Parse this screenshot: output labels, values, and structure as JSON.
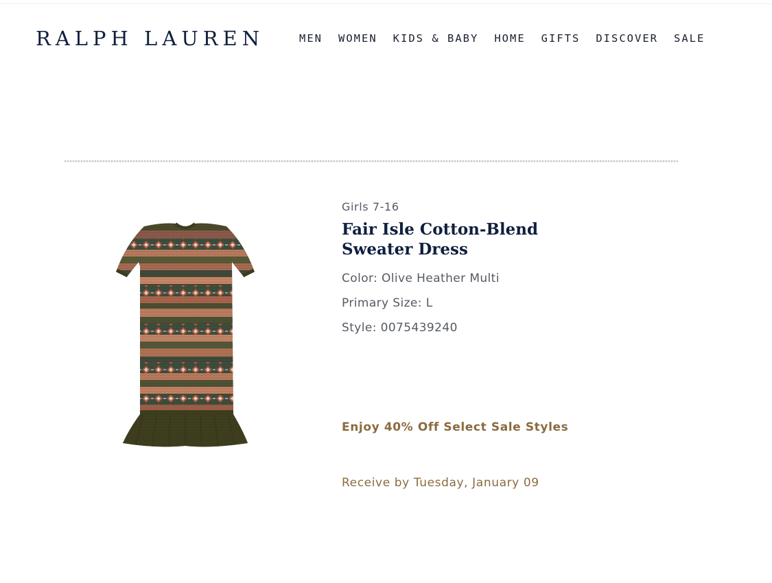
{
  "header": {
    "logo": "RALPH LAUREN",
    "nav": [
      "MEN",
      "WOMEN",
      "KIDS & BABY",
      "HOME",
      "GIFTS",
      "DISCOVER",
      "SALE"
    ]
  },
  "product": {
    "category": "Girls 7-16",
    "title": "Fair Isle Cotton-Blend Sweater Dress",
    "color": "Color: Olive Heather Multi",
    "size": "Primary Size: L",
    "style": "Style: 0075439240",
    "promo": "Enjoy 40% Off Select Sale Styles",
    "delivery": "Receive by Tuesday, January 09",
    "image_icon": "sweater-dress-image"
  },
  "colors": {
    "navy": "#0f1f3d",
    "gold": "#8b6b3e",
    "gray_text": "#555a63",
    "olive": "#4a4a24"
  }
}
